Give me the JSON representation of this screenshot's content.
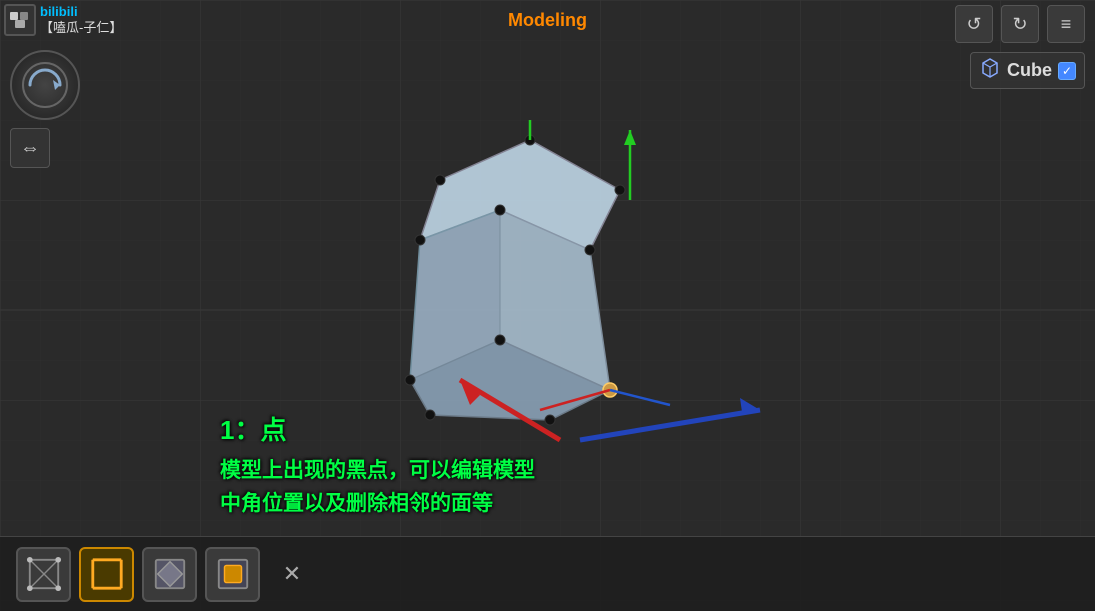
{
  "header": {
    "title": "Modeling"
  },
  "logo": {
    "channel_name": "【嗑瓜-子仁】"
  },
  "top_right": {
    "undo_label": "↺",
    "redo_label": "↻",
    "menu_label": "≡"
  },
  "object_panel": {
    "name": "Cube",
    "checked": true
  },
  "annotation": {
    "title": "1：点",
    "body": "模型上出现的黑点，可以编辑模型\n中角位置以及删除相邻的面等"
  },
  "toolbar": {
    "tools": [
      {
        "id": "vertex-mode",
        "label": "顶点模式",
        "active": false,
        "icon": "vertex"
      },
      {
        "id": "edge-mode",
        "label": "边模式",
        "active": true,
        "icon": "edge"
      },
      {
        "id": "face-mode",
        "label": "面模式",
        "active": false,
        "icon": "face"
      },
      {
        "id": "object-mode",
        "label": "物体模式",
        "active": false,
        "icon": "object"
      }
    ],
    "close_label": "✕"
  },
  "colors": {
    "accent_orange": "#ff8800",
    "green_annotation": "#00ff44",
    "axis_x": "#cc2222",
    "axis_y": "#22cc22",
    "axis_z": "#2222cc",
    "model_fill": "#b0c4d8",
    "model_stroke": "#888"
  }
}
